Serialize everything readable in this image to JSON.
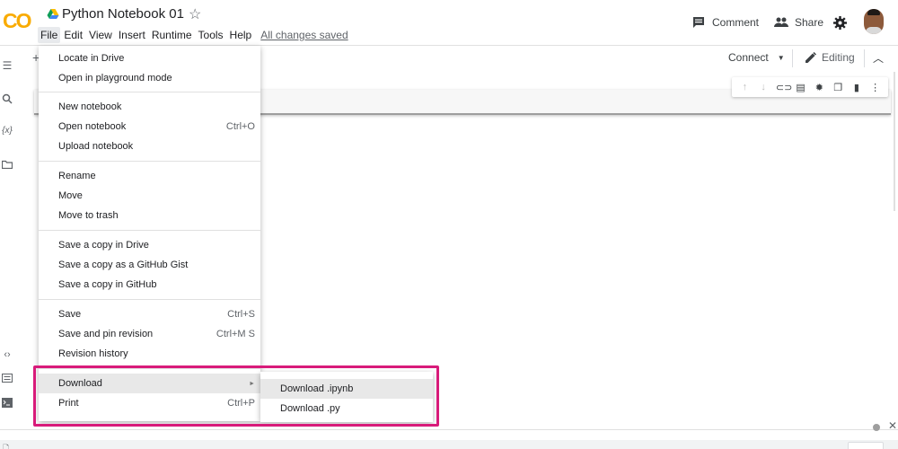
{
  "app": {
    "logo_text": "CO",
    "notebook_title": "Python Notebook 01",
    "saved_status": "All changes saved"
  },
  "menubar": [
    "File",
    "Edit",
    "View",
    "Insert",
    "Runtime",
    "Tools",
    "Help"
  ],
  "header_actions": {
    "comment_label": "Comment",
    "share_label": "Share"
  },
  "toolbar": {
    "connect_label": "Connect",
    "editing_label": "Editing"
  },
  "file_menu": {
    "items": [
      {
        "label": "Locate in Drive",
        "shortcut": ""
      },
      {
        "label": "Open in playground mode",
        "shortcut": ""
      },
      {
        "label": "New notebook",
        "shortcut": ""
      },
      {
        "label": "Open notebook",
        "shortcut": "Ctrl+O"
      },
      {
        "label": "Upload notebook",
        "shortcut": ""
      },
      {
        "label": "Rename",
        "shortcut": ""
      },
      {
        "label": "Move",
        "shortcut": ""
      },
      {
        "label": "Move to trash",
        "shortcut": ""
      },
      {
        "label": "Save a copy in Drive",
        "shortcut": ""
      },
      {
        "label": "Save a copy as a GitHub Gist",
        "shortcut": ""
      },
      {
        "label": "Save a copy in GitHub",
        "shortcut": ""
      },
      {
        "label": "Save",
        "shortcut": "Ctrl+S"
      },
      {
        "label": "Save and pin revision",
        "shortcut": "Ctrl+M S"
      },
      {
        "label": "Revision history",
        "shortcut": ""
      },
      {
        "label": "Download",
        "shortcut": ""
      },
      {
        "label": "Print",
        "shortcut": "Ctrl+P"
      }
    ]
  },
  "download_submenu": {
    "items": [
      "Download .ipynb",
      "Download .py"
    ]
  },
  "icons": {
    "drive": "google-drive-icon",
    "star": "star-icon",
    "comment": "comment-icon",
    "share": "people-icon",
    "settings": "gear-icon",
    "editing": "pencil-icon"
  },
  "colors": {
    "logo": "#f9ab00",
    "highlight_frame": "#d81b7a",
    "menu_hover": "#e8e8e8"
  }
}
